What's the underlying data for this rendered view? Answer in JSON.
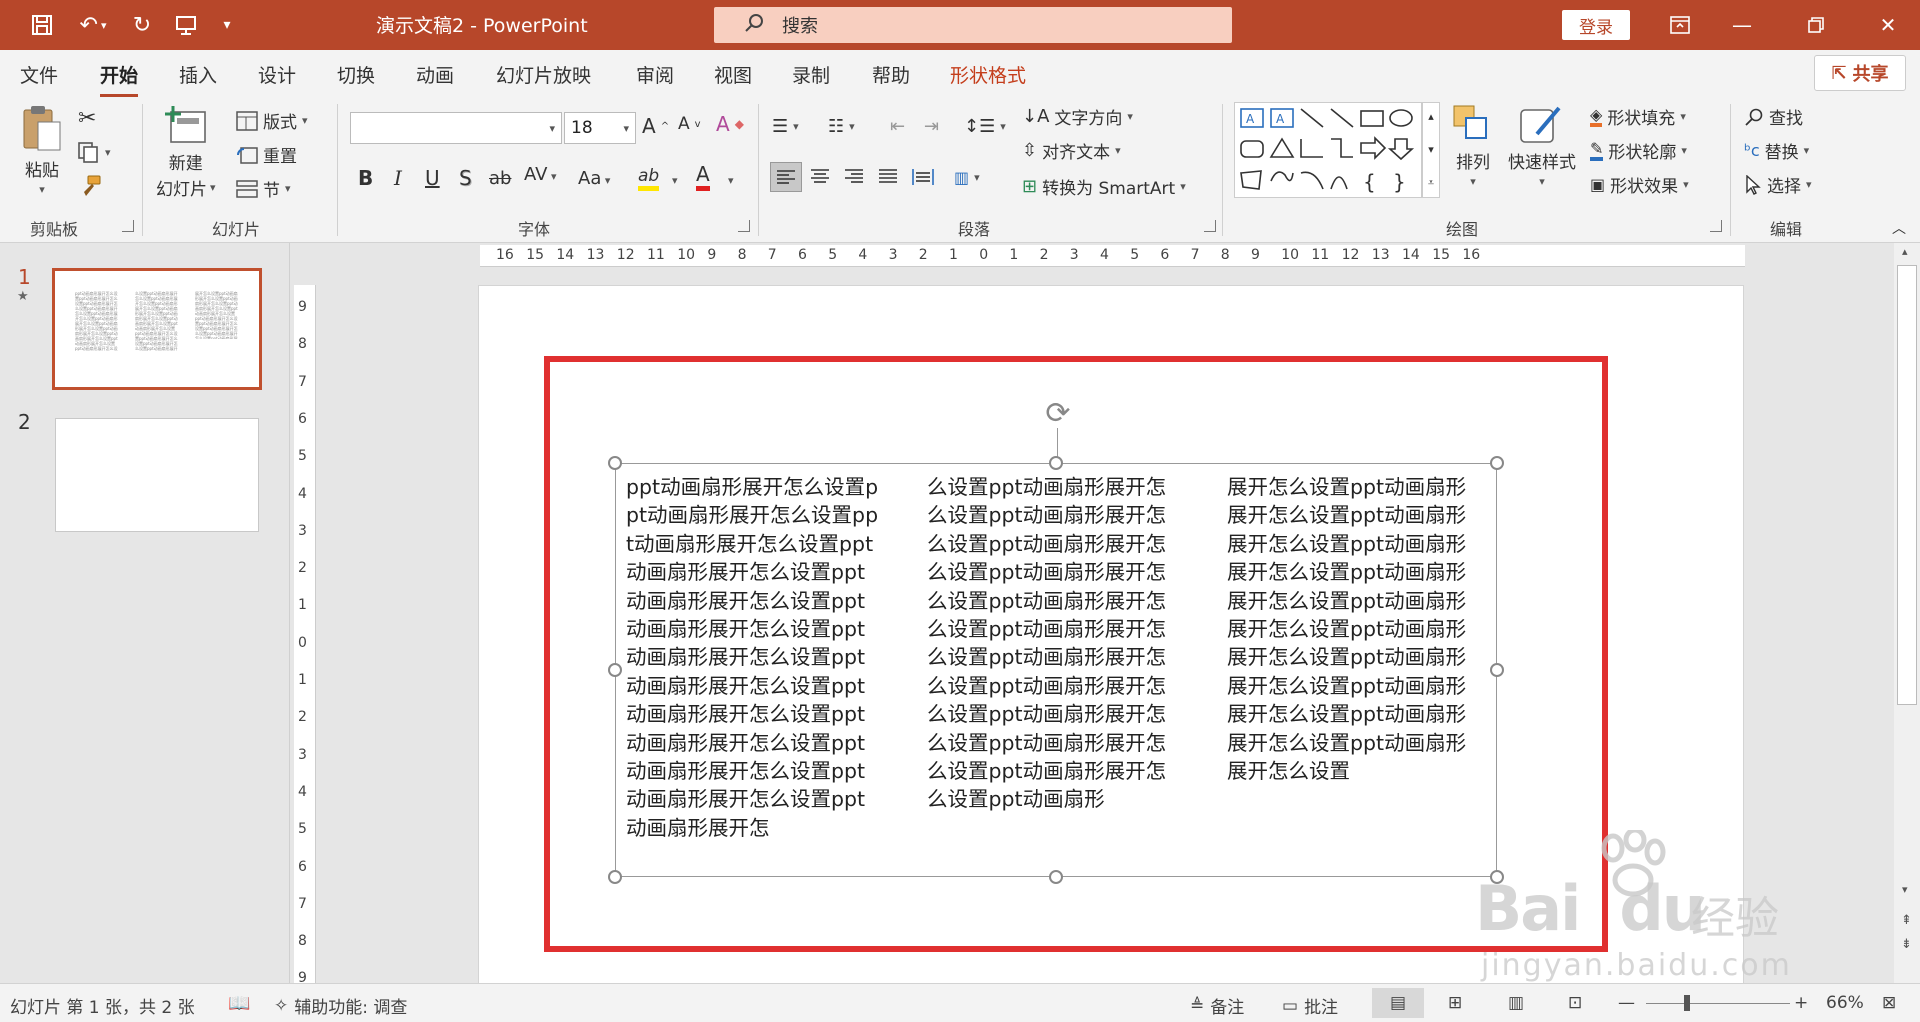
{
  "app": {
    "doc_title": "演示文稿2",
    "separator": " - ",
    "app_name": "PowerPoint",
    "search_placeholder": "搜索",
    "login": "登录",
    "share": "共享"
  },
  "menu": {
    "tabs": [
      "文件",
      "开始",
      "插入",
      "设计",
      "切换",
      "动画",
      "幻灯片放映",
      "审阅",
      "视图",
      "录制",
      "帮助",
      "形状格式"
    ],
    "active_index": 1
  },
  "ribbon": {
    "clipboard": {
      "label": "剪贴板",
      "paste": "粘贴"
    },
    "slides": {
      "label": "幻灯片",
      "new_slide_1": "新建",
      "new_slide_2": "幻灯片",
      "layout": "版式",
      "reset": "重置",
      "section": "节"
    },
    "font": {
      "label": "字体",
      "font_name": "",
      "font_size": "18",
      "bold": "B",
      "italic": "I",
      "underline": "U",
      "strike": "S",
      "strike2": "ab",
      "spacing": "AV",
      "case": "Aa",
      "highlight": "ab",
      "color": "A"
    },
    "paragraph": {
      "label": "段落",
      "text_direction": "文字方向",
      "align_text": "对齐文本",
      "smartart": "转换为 SmartArt"
    },
    "drawing": {
      "label": "绘图",
      "arrange": "排列",
      "quick_styles": "快速样式",
      "fill": "形状填充",
      "outline": "形状轮廓",
      "effects": "形状效果"
    },
    "editing": {
      "label": "编辑",
      "find": "查找",
      "replace": "替换",
      "select": "选择"
    }
  },
  "slides_panel": {
    "items": [
      {
        "number": "1"
      },
      {
        "number": "2"
      }
    ]
  },
  "ruler": {
    "h_labels": [
      "16",
      "15",
      "14",
      "13",
      "12",
      "11",
      "10",
      "9",
      "8",
      "7",
      "6",
      "5",
      "4",
      "3",
      "2",
      "1",
      "0",
      "1",
      "2",
      "3",
      "4",
      "5",
      "6",
      "7",
      "8",
      "9",
      "10",
      "11",
      "12",
      "13",
      "14",
      "15",
      "16"
    ],
    "v_labels": [
      "9",
      "8",
      "7",
      "6",
      "5",
      "4",
      "3",
      "2",
      "1",
      "0",
      "1",
      "2",
      "3",
      "4",
      "5",
      "6",
      "7",
      "8",
      "9"
    ]
  },
  "slide": {
    "columns": [
      "ppt动画扇形展开怎么设置ppt动画扇形展开怎么设置ppt动画扇形展开怎么设置ppt动画扇形展开怎么设置ppt动画扇形展开怎么设置ppt动画扇形展开怎么设置ppt动画扇形展开怎么设置ppt动画扇形展开怎么设置ppt动画扇形展开怎么设置ppt动画扇形展开怎么设置ppt动画扇形展开怎么设置ppt动画扇形展开怎么设置ppt动画扇形展开怎",
      "么设置ppt动画扇形展开怎么设置ppt动画扇形展开怎么设置ppt动画扇形展开怎么设置ppt动画扇形展开怎么设置ppt动画扇形展开怎么设置ppt动画扇形展开怎么设置ppt动画扇形展开怎么设置ppt动画扇形展开怎么设置ppt动画扇形展开怎么设置ppt动画扇形展开怎么设置ppt动画扇形展开怎么设置ppt动画扇形",
      "展开怎么设置ppt动画扇形展开怎么设置ppt动画扇形展开怎么设置ppt动画扇形展开怎么设置ppt动画扇形展开怎么设置ppt动画扇形展开怎么设置ppt动画扇形展开怎么设置ppt动画扇形展开怎么设置ppt动画扇形展开怎么设置ppt动画扇形展开怎么设置ppt动画扇形展开怎么设置"
    ],
    "frame_color": "#e03030"
  },
  "status": {
    "slide_info": "幻灯片 第 1 张，共 2 张",
    "accessibility": "辅助功能: 调查",
    "notes": "备注",
    "comments": "批注",
    "zoom": "66%"
  },
  "watermark": {
    "brand": "Bai",
    "brand2": "du",
    "cn": "经验",
    "url": "jingyan.baidu.com"
  },
  "colors": {
    "accent": "#b7472a",
    "search_bg": "#f8cfc0"
  }
}
